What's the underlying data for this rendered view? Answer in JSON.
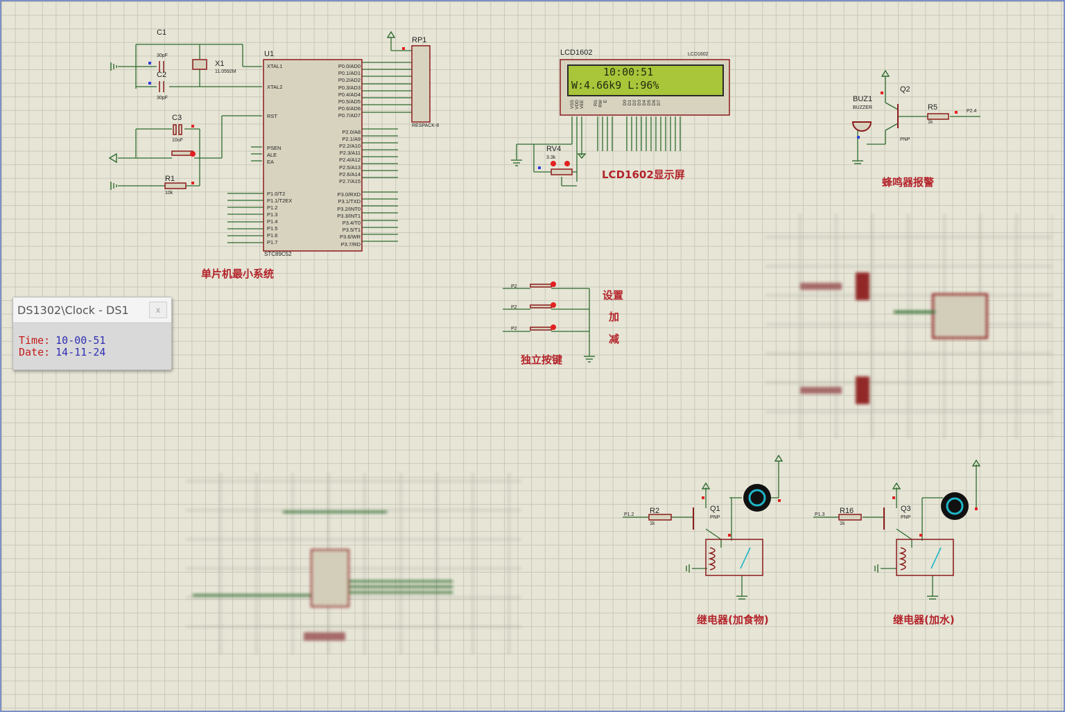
{
  "popup": {
    "title": "DS1302\\Clock - DS1",
    "close": "x",
    "time_label": "Time:",
    "time_value": "10-00-51",
    "date_label": "Date:",
    "date_value": "14-11-24"
  },
  "lcd": {
    "ref": "LCD1602",
    "model": "LCD1602",
    "line1": "10:00:51",
    "line2": "W:4.66k9  L:96%",
    "pins": [
      "VSS",
      "VDD",
      "VEE",
      "RS",
      "RW",
      "E",
      "D0",
      "D1",
      "D2",
      "D3",
      "D4",
      "D5",
      "D6",
      "D7"
    ]
  },
  "labels": {
    "mcu_caption": "单片机最小系统",
    "lcd_caption": "LCD1602显示屏",
    "buzzer_caption": "蜂鸣器报警",
    "keys_caption": "独立按键",
    "key_set": "设置",
    "key_add": "加",
    "key_sub": "减",
    "relay_food_caption": "继电器(加食物)",
    "relay_water_caption": "继电器(加水)"
  },
  "mcu": {
    "ref": "U1",
    "part": "STC89C52",
    "left_pins": [
      "XTAL1",
      "XTAL2",
      "RST",
      "PSEN",
      "ALE",
      "EA",
      "P1.0/T2",
      "P1.1/T2EX",
      "P1.2",
      "P1.3",
      "P1.4",
      "P1.5",
      "P1.6",
      "P1.7"
    ],
    "right_pins": [
      "P0.0/AD0",
      "P0.1/AD1",
      "P0.2/AD2",
      "P0.3/AD3",
      "P0.4/AD4",
      "P0.5/AD5",
      "P0.6/AD6",
      "P0.7/AD7",
      "P2.0/A8",
      "P2.1/A9",
      "P2.2/A10",
      "P2.3/A11",
      "P2.4/A12",
      "P2.5/A13",
      "P2.6/A14",
      "P2.7/A15",
      "P3.0/RXD",
      "P3.1/TXD",
      "P3.2/INT0",
      "P3.3/INT1",
      "P3.4/T0",
      "P3.5/T1",
      "P3.6/WR",
      "P3.7/RD"
    ]
  },
  "components": {
    "c1": "C1",
    "c1_val": "30pF",
    "c2": "C2",
    "c2_val": "30pF",
    "c3": "C3",
    "c3_val": "10uF",
    "x1": "X1",
    "x1_val": "11.0592M",
    "r1": "R1",
    "r1_val": "10k",
    "rp1": "RP1",
    "rp1_val": "RESPACK-8",
    "rv4": "RV4",
    "rv4_val": "3.3k",
    "buz1": "BUZ1",
    "buz1_val": "BUZZER",
    "q2": "Q2",
    "q2_type": "PNP",
    "r5": "R5",
    "r5_val": "1k",
    "r5_net": "P2.4",
    "r2": "R2",
    "r2_val": "1k",
    "r2_net": "P1.2",
    "q1": "Q1",
    "q1_type": "PNP",
    "r16": "R16",
    "r16_val": "1k",
    "r16_net": "P1.3",
    "q3": "Q3",
    "q3_type": "PNP",
    "key_net": "P2"
  },
  "colors": {
    "wire": "#2e6b2e",
    "component": "#8b1a1a",
    "chip_fill": "#d8d3bf",
    "label_red": "#b3232a",
    "lcd_bg": "#a9c53a",
    "pin_blue": "#3042d8",
    "pin_red": "#e22020"
  }
}
